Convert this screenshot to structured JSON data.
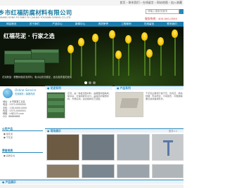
{
  "header": {
    "toplinks": "首页 › 联系我们 › 在线留言 › 网站地图 › 加入收藏",
    "company_name": "乡市红福防腐材料有限公司",
    "company_name_en": "XIANG HONG FU FANG FU CAILIAO YOUXIAN GONGSI CO.,LTD",
    "search_placeholder": "请输入搜索关键词",
    "tel": "服务热线：400-000-0000"
  },
  "nav": [
    "网站首页",
    "关于我们",
    "产品中心",
    "新闻中心",
    "资质荣誉",
    "工程案例",
    "在线留言",
    "联系我们"
  ],
  "banner": {
    "headline": "红福花泥 · 行家之选",
    "caption": "花泥新品：酚醛树脂发泡材料，吸水后形态稳定，适合各类插花使用"
  },
  "service": {
    "title": "Online Service",
    "subtitle": "在线服务 / 客服热线",
    "lines": [
      "地址：乡市某某工业区",
      "电话：0373-0000000",
      "手机：138-0000-0000",
      "传真：0373-0000001",
      "邮箱：hf@123.com",
      "QQ：88888888"
    ]
  },
  "products": {
    "section1_label": "● 花泥系列",
    "section1_desc": "花泥，是一种发泡型材料，由酚醛树脂制成，吸水后，可保持鲜花水分，是插花的理想材料，方便实用，适合各种花艺造型。",
    "section2_label": "● 产品系列",
    "section2_desc": "干花泥主要用于插干花、仿真花，质地较硬，形态稳定，不易变形，可根据需要切割成各种形状。"
  },
  "left_panels": {
    "panel1_title": "公司产品",
    "panel1_items": [
      "● 湿花泥",
      "● 干花泥"
    ],
    "panel2_title": "荣誉资质",
    "panel2_items": [
      "● 资质证书"
    ]
  },
  "gallery": {
    "label": "● 现场展示",
    "more": "更多>>"
  },
  "footer_label": "● 产品展示"
}
